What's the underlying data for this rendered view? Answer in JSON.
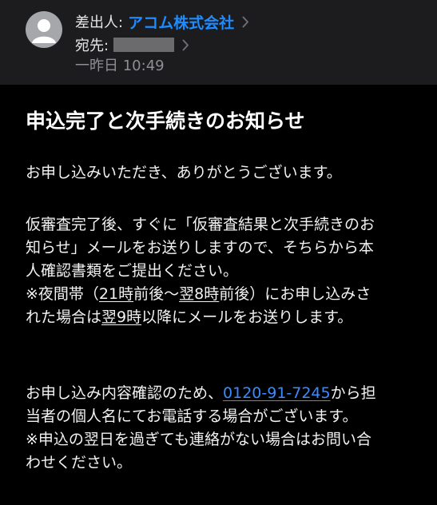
{
  "header": {
    "from_label": "差出人:",
    "sender": "アコム株式会社",
    "to_label": "宛先:",
    "date": "一昨日 10:49"
  },
  "email": {
    "subject": "申込完了と次手続きのお知らせ",
    "greeting": "お申し込みいただき、ありがとうございます。",
    "p2": {
      "l1": "仮審査完了後、すぐに「仮審査結果と次手続きのお",
      "l2": "知らせ」メールをお送りしますので、そちらから本",
      "l3": "人確認書類をご提出ください。",
      "l4_a": "※夜間帯（",
      "l4_b": "21時",
      "l4_c": "前後〜",
      "l4_d": "翌8時",
      "l4_e": "前後）にお申し込みさ",
      "l5_a": "れた場合は",
      "l5_b": "翌9時",
      "l5_c": "以降にメールをお送りします。"
    },
    "p3": {
      "l1_a": "お申し込み内容確認のため、",
      "phone": "0120-91-7245",
      "l1_b": "から担",
      "l2": "当者の個人名にてお電話する場合がございます。",
      "l3": "※申込の翌日を過ぎても連絡がない場合はお問い合",
      "l4": "わせください。"
    }
  }
}
